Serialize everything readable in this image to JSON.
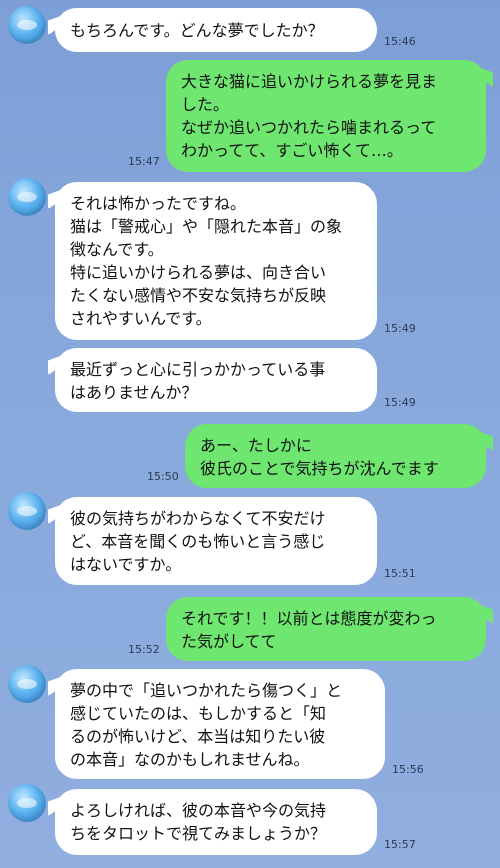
{
  "messages": [
    {
      "side": "left",
      "text": "もちろんです。どんな夢でしたか？",
      "time": "15:46"
    },
    {
      "side": "right",
      "text": "大きな猫に追いかけられる夢を見ま\nした。\nなぜか追いつかれたら噛まれるって\nわかってて、すごい怖くて…。",
      "time": "15:47"
    },
    {
      "side": "left",
      "text": "それは怖かったですね。\n猫は「警戒心」や「隠れた本音」の象\n徴なんです。\n特に追いかけられる夢は、向き合い\nたくない感情や不安な気持ちが反映\nされやすいんです。",
      "time": "15:49"
    },
    {
      "side": "left",
      "text": "最近ずっと心に引っかかっている事\nはありませんか？",
      "time": "15:49"
    },
    {
      "side": "right",
      "text": "あー、たしかに\n彼氏のことで気持ちが沈んでます",
      "time": "15:50"
    },
    {
      "side": "left",
      "text": "彼の気持ちがわからなくて不安だけ\nど、本音を聞くのも怖いと言う感じ\nはないですか。",
      "time": "15:51"
    },
    {
      "side": "right",
      "text": "それです！！以前とは態度が変わっ\nた気がしてて",
      "time": "15:52"
    },
    {
      "side": "left",
      "text": "夢の中で「追いつかれたら傷つく」と\n感じていたのは、もしかすると「知\nるのが怖いけど、本当は知りたい彼\nの本音」なのかもしれませんね。",
      "time": "15:56"
    },
    {
      "side": "left",
      "text": "よろしければ、彼の本音や今の気持\nちをタロットで視てみましょうか？",
      "time": "15:57"
    }
  ],
  "colors": {
    "background": "#87a8dc",
    "incoming_bubble": "#ffffff",
    "outgoing_bubble": "#6fe66f"
  },
  "icons": {
    "avatar": "blue-avatar-icon"
  }
}
